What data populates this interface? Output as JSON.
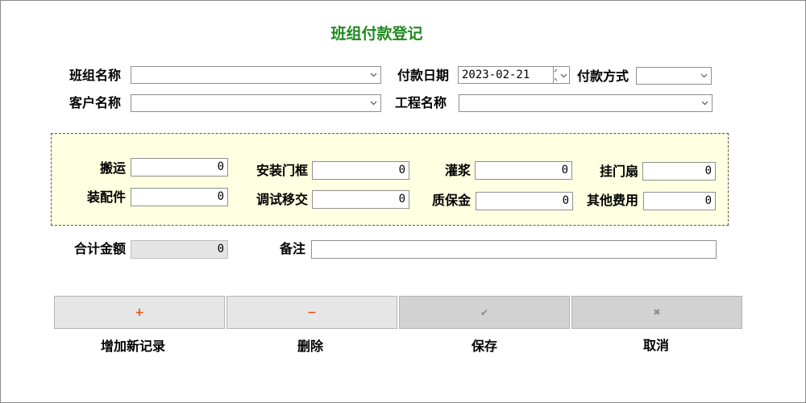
{
  "title": "班组付款登记",
  "fields": {
    "team_name_label": "班组名称",
    "team_name_value": "",
    "pay_date_label": "付款日期",
    "pay_date_value": "2023-02-21",
    "pay_method_label": "付款方式",
    "pay_method_value": "",
    "customer_label": "客户名称",
    "customer_value": "",
    "project_label": "工程名称",
    "project_value": ""
  },
  "costs": {
    "banyun_label": "搬运",
    "banyun_value": "0",
    "anzhuang_label": "安装门框",
    "anzhuang_value": "0",
    "guanjiang_label": "灌浆",
    "guanjiang_value": "0",
    "guamenshan_label": "挂门扇",
    "guamenshan_value": "0",
    "peijian_label": "装配件",
    "peijian_value": "0",
    "tiaoshi_label": "调试移交",
    "tiaoshi_value": "0",
    "zhibaojin_label": "质保金",
    "zhibaojin_value": "0",
    "qita_label": "其他费用",
    "qita_value": "0"
  },
  "total_label": "合计金额",
  "total_value": "0",
  "remark_label": "备注",
  "remark_value": "",
  "buttons": {
    "add_label": "增加新记录",
    "add_icon": "+",
    "delete_label": "删除",
    "delete_icon": "−",
    "save_label": "保存",
    "save_icon": "✔",
    "cancel_label": "取消",
    "cancel_icon": "✖"
  },
  "colors": {
    "title": "#1f8a1f",
    "add_icon": "#e8541a",
    "delete_icon": "#e8541a",
    "panel_bg": "#ffffe1",
    "disabled_icon": "#8c8c8c"
  }
}
